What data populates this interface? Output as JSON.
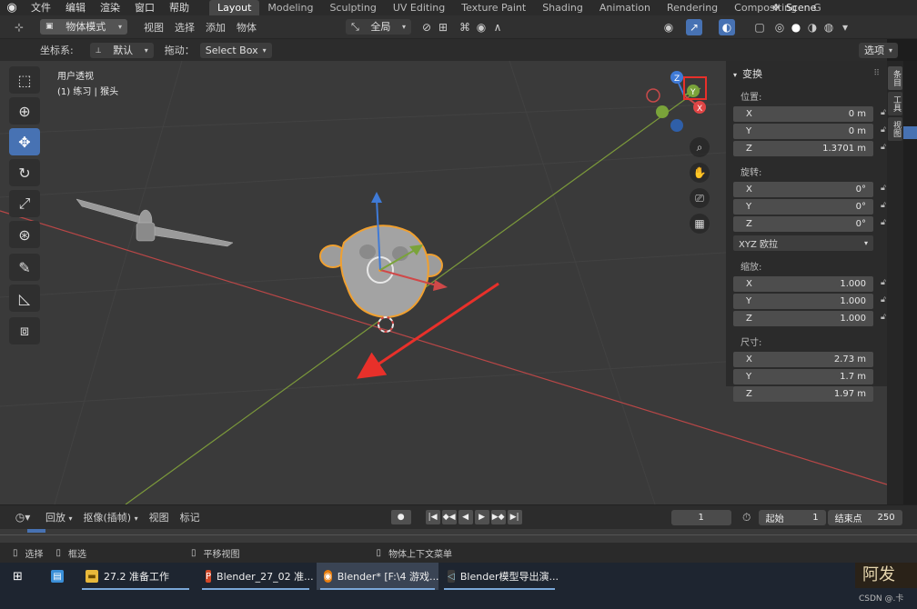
{
  "menubar": {
    "logo_icon": "blender-logo-icon",
    "menus": [
      "文件",
      "编辑",
      "渲染",
      "窗口",
      "帮助"
    ],
    "workspaces": [
      "Layout",
      "Modeling",
      "Sculpting",
      "UV Editing",
      "Texture Paint",
      "Shading",
      "Animation",
      "Rendering",
      "Compositing",
      "G"
    ],
    "active_workspace": "Layout",
    "scene": "Scene"
  },
  "header": {
    "mode": "物体模式",
    "menus": [
      "视图",
      "选择",
      "添加",
      "物体"
    ],
    "transform_orientation": "全局",
    "options_label": "选项"
  },
  "subheader": {
    "coord_label": "坐标系:",
    "coord_value": "默认",
    "drag_label": "拖动：",
    "drag_value": "Select Box"
  },
  "viewport": {
    "view_name": "用户透视",
    "context": "(1) 练习 | 猴头",
    "gizmo": {
      "x": "X",
      "y": "Y",
      "z": "Z"
    },
    "nav_icons": [
      "zoom-icon",
      "hand-pan-icon",
      "camera-icon",
      "grid-perspective-icon"
    ],
    "tools": [
      "select-box-icon",
      "cursor-icon",
      "move-icon",
      "rotate-icon",
      "scale-icon",
      "transform-icon",
      "annotate-icon",
      "measure-icon",
      "add-cube-icon"
    ],
    "active_tool": 2
  },
  "npanel": {
    "title": "变换",
    "location_label": "位置:",
    "location": [
      {
        "axis": "X",
        "value": "0 m"
      },
      {
        "axis": "Y",
        "value": "0 m"
      },
      {
        "axis": "Z",
        "value": "1.3701 m"
      }
    ],
    "rotation_label": "旋转:",
    "rotation": [
      {
        "axis": "X",
        "value": "0°"
      },
      {
        "axis": "Y",
        "value": "0°"
      },
      {
        "axis": "Z",
        "value": "0°"
      }
    ],
    "rotation_mode": "XYZ 欧拉",
    "scale_label": "缩放:",
    "scale": [
      {
        "axis": "X",
        "value": "1.000"
      },
      {
        "axis": "Y",
        "value": "1.000"
      },
      {
        "axis": "Z",
        "value": "1.000"
      }
    ],
    "dimensions_label": "尺寸:",
    "dimensions": [
      {
        "axis": "X",
        "value": "2.73 m"
      },
      {
        "axis": "Y",
        "value": "1.7 m"
      },
      {
        "axis": "Z",
        "value": "1.97 m"
      }
    ],
    "tabs": [
      "条目",
      "工具",
      "视图"
    ]
  },
  "timeline": {
    "playback": "回放",
    "keying": "抠像(插帧)",
    "view": "视图",
    "marker": "标记",
    "current_frame": "1",
    "start_label": "起始",
    "start": "1",
    "end_label": "结束点",
    "end": "250"
  },
  "status": {
    "select": "选择",
    "box_select": "框选",
    "pan": "平移视图",
    "context_menu": "物体上下文菜单"
  },
  "taskbar": {
    "items": [
      {
        "label": "27.2 准备工作",
        "icon": "folder-icon"
      },
      {
        "label": "Blender_27_02 准...",
        "icon": "powerpoint-icon"
      },
      {
        "label": "Blender* [F:\\4 游戏...",
        "icon": "blender-icon"
      },
      {
        "label": "Blender模型导出演...",
        "icon": "vscode-icon"
      }
    ],
    "active_index": 2,
    "watermark": "阿发",
    "credit": "CSDN @.卡"
  },
  "colors": {
    "accent": "#4772b3",
    "axis_red": "#c84a4a",
    "axis_green": "#7aa33a",
    "axis_blue": "#3f7ad6",
    "selection_orange": "#f0a030",
    "annotation_red": "#e8302a"
  }
}
